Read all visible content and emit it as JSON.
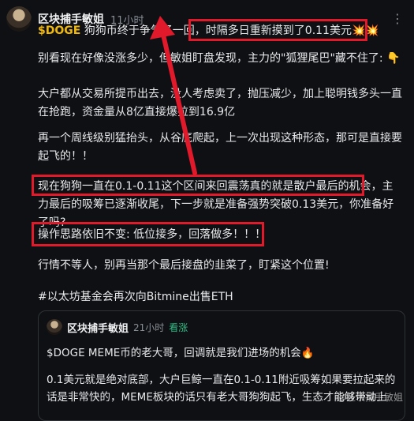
{
  "author": {
    "name": "区块捕手敏姐",
    "time": "11小时"
  },
  "post": {
    "ticker": "$DOGE",
    "line1_rest": " 狗狗币终于争气了一回，",
    "line1_boxed": "时隔多日重新摸到了0.11美元💥💥",
    "p2": "别看现在好像没涨多少，但敏姐盯盘发现，主力的\"狐狸尾巴\"藏不住了: 👇",
    "p3": "大户都从交易所提币出去，没人考虑卖了，抛压减少，加上聪明钱多头一直在抢跑，资金量从8亿直接爆拉到16.9亿",
    "p4": "再一个周线级别猛抬头，从谷底爬起，上一次出现这种形态，那可是直接要起飞的！！",
    "p5_boxed": "现在狗狗一直在0.1-0.11这个区间来回震荡真的就是散户最后的机会，",
    "p5_rest": "主力最后的吸筹已逐渐收尾，下一步就是准备强势突破0.13美元，你准备好了吗?",
    "p6_boxed": "操作思路依旧不变: 低位接多，回落做多！！！",
    "p7": "行情不等人，别再当那个最后接盘的韭菜了，盯紧这个位置!",
    "hashtag": "#以太坊基金会再次向Bitmine出售ETH"
  },
  "quote": {
    "author": "区块捕手敏姐",
    "time": "21小时",
    "tag": "看涨",
    "p1": "$DOGE MEME币的老大哥，回调就是我们进场的机会🔥",
    "p2": "0.1美元就是绝对底部，大户巨鲸一直在0.1-0.11附近吸筹如果要拉起来的话是非常快的，MEME板块的话只有老大哥狗狗起飞，生态才能够带动上"
  },
  "watermark": "@区块捕手敏姐",
  "colors": {
    "background": "#0e1013",
    "highlight_box": "#e0192b",
    "ticker": "#f0b90b",
    "bullish_tag": "#2ebd85"
  },
  "icons": {
    "more": "more-dots-icon",
    "arrow": "red-arrow-annotation"
  }
}
